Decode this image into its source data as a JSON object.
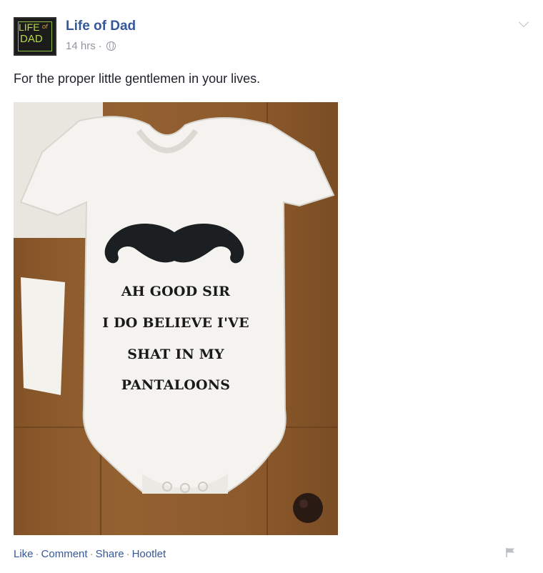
{
  "post": {
    "page_name": "Life of Dad",
    "timestamp": "14 hrs",
    "timestamp_separator": "·",
    "privacy_icon": "globe-icon",
    "caption": "For the proper little gentlemen in your lives.",
    "avatar_logo": {
      "line1": "LIFE",
      "line1_small": "of",
      "line2": "DAD"
    },
    "photo_text": [
      "AH GOOD SIR",
      "I DO BELIEVE I'VE",
      "SHAT IN MY",
      "PANTALOONS"
    ],
    "actions": {
      "like": "Like",
      "comment": "Comment",
      "share": "Share",
      "hootlet": "Hootlet",
      "separator": "·"
    },
    "icons": {
      "menu": "chevron-down-icon",
      "report": "flag-icon"
    }
  },
  "colors": {
    "link_blue": "#365899",
    "meta_gray": "#90949c",
    "text": "#1d2129",
    "wood": "#8b5a2b",
    "onesie": "#f4f3ef"
  }
}
